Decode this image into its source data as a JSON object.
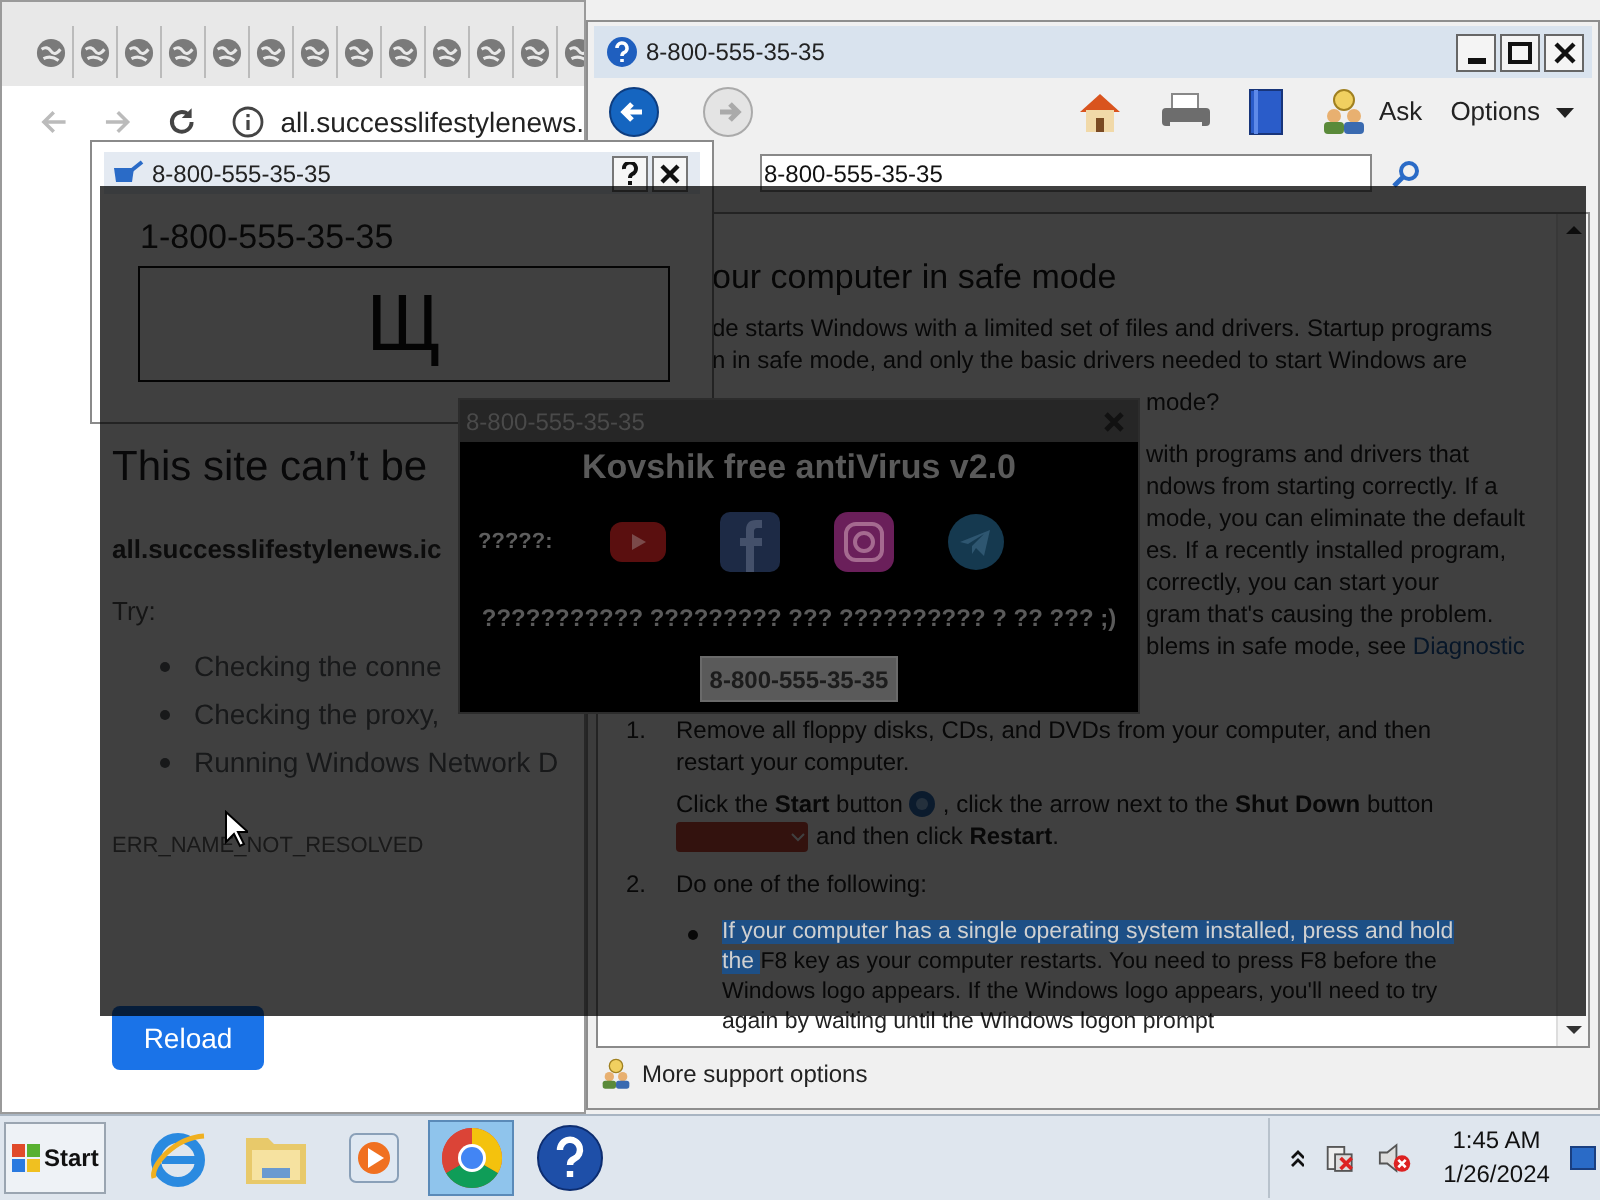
{
  "browser": {
    "address": "all.successlifestylenews.",
    "page": {
      "heading": "This site can’t be",
      "host": "all.successlifestylenews.ic",
      "try_label": "Try:",
      "suggestions": [
        "Checking the conne",
        "Checking the proxy,",
        "Running Windows Network D"
      ],
      "error_code": "ERR_NAME_NOT_RESOLVED",
      "reload_button": "Reload"
    }
  },
  "help_window": {
    "title": "8-800-555-35-35",
    "nav": [
      {
        "kind": "back",
        "disabled": false
      },
      {
        "kind": "forward",
        "disabled": true
      }
    ],
    "ask": "Ask",
    "options": "Options",
    "search": {
      "value": "8-800-555-35-35"
    },
    "heading": "our computer in safe mode",
    "intro_lines": [
      "de starts Windows with a limited set of files and drivers. Startup programs",
      "n in safe mode, and only the basic drivers needed to start Windows are"
    ],
    "side_paragraphs": [
      [
        {
          "text": "mode?"
        }
      ],
      [
        {
          "text": "with programs and drivers that"
        },
        {
          "text": "ndows from starting correctly. If a"
        },
        {
          "text": "mode, you can eliminate the default"
        },
        {
          "text": "es. If a recently installed program,"
        },
        {
          "text": "correctly, you can start your"
        },
        {
          "text": "gram that's causing the problem."
        },
        {
          "text": "blems in safe mode, see ",
          "link": "Diagnostic"
        }
      ]
    ],
    "steps": [
      {
        "number": "1.",
        "text": "Remove all floppy disks, CDs, and DVDs from your computer, and then restart your computer.",
        "detail": [
          "Click the **Start** button",
          ", click the arrow next to the **Shut Down** button",
          "and then click **Restart**."
        ]
      },
      {
        "number": "2.",
        "text": "Do one of the following:",
        "bullet": [
          {
            "text": "If your computer has a single operating system installed, press and hold the ",
            "selected": true
          },
          {
            "text": "F8 key as your computer restarts. You need to press F8 before the Windows logo appears. If the Windows logo appears, you'll need to try again by waiting until the Windows logon prompt",
            "selected": false
          }
        ]
      }
    ],
    "footer": "More support options"
  },
  "phone_dialog": {
    "title": "8-800-555-35-35",
    "phone": "1-800-555-35-35",
    "glyph": "Щ"
  },
  "popup": {
    "title": "8-800-555-35-35",
    "heading": "Kovshik free antiVirus v2.0",
    "social_label": "?????:",
    "socials": [
      {
        "kind": "youtube"
      },
      {
        "kind": "facebook"
      },
      {
        "kind": "instagram"
      },
      {
        "kind": "telegram"
      }
    ],
    "message": "??????????? ????????? ??? ?????????? ? ?? ??? ;)",
    "button": "8-800-555-35-35"
  },
  "taskbar": {
    "start": "Start",
    "apps": [
      {
        "kind": "ie",
        "selected": false
      },
      {
        "kind": "folder",
        "selected": false
      },
      {
        "kind": "media",
        "selected": false
      },
      {
        "kind": "chrome",
        "selected": true
      },
      {
        "kind": "help",
        "selected": false
      }
    ],
    "time": "1:45 AM",
    "date": "1/26/2024"
  }
}
